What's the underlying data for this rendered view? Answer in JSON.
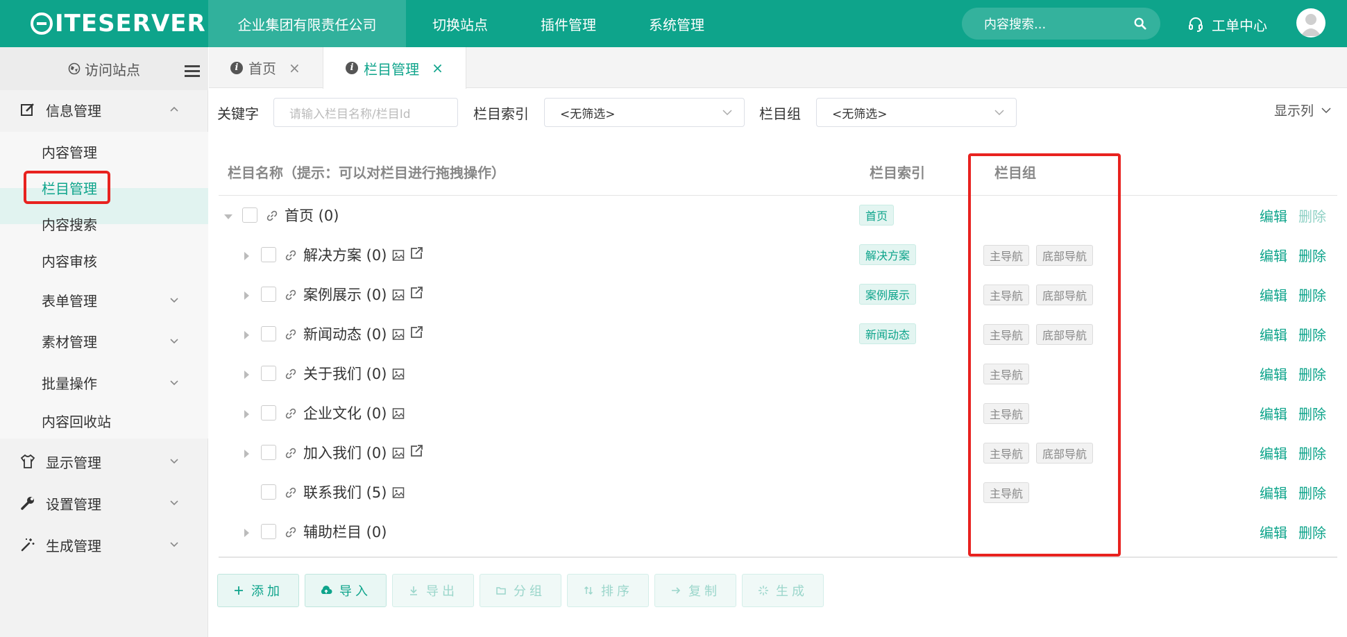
{
  "brand": {
    "logo_text": "ITESERVER"
  },
  "topnav": {
    "items": [
      "企业集团有限责任公司",
      "切换站点",
      "插件管理",
      "系统管理"
    ],
    "search_placeholder": "内容搜索...",
    "workorder": "工单中心"
  },
  "sidebar": {
    "visit": "访问站点",
    "groups": {
      "info": "信息管理",
      "display": "显示管理",
      "settings": "设置管理",
      "generate": "生成管理"
    },
    "subs": {
      "content": "内容管理",
      "channel": "栏目管理",
      "search": "内容搜索",
      "audit": "内容审核",
      "form": "表单管理",
      "material": "素材管理",
      "batch": "批量操作",
      "recycle": "内容回收站"
    }
  },
  "tabs": {
    "home": "首页",
    "channel": "栏目管理",
    "close": "×"
  },
  "filters": {
    "keyword_label": "关键字",
    "keyword_placeholder": "请输入栏目名称/栏目Id",
    "index_label": "栏目索引",
    "index_value": "<无筛选>",
    "group_label": "栏目组",
    "group_value": "<无筛选>",
    "show_columns": "显示列"
  },
  "table": {
    "headers": {
      "name": "栏目名称（提示：可以对栏目进行拖拽操作）",
      "index": "栏目索引",
      "group": "栏目组"
    },
    "edit": "编辑",
    "delete": "删除",
    "rows": [
      {
        "name": "首页 (0)",
        "index": "首页",
        "groups": [],
        "level": 0,
        "expanded": true,
        "image": false,
        "external": false,
        "arrow": true,
        "delete_disabled": true
      },
      {
        "name": "解决方案 (0)",
        "index": "解决方案",
        "groups": [
          "主导航",
          "底部导航"
        ],
        "level": 1,
        "image": true,
        "external": true,
        "arrow": true
      },
      {
        "name": "案例展示 (0)",
        "index": "案例展示",
        "groups": [
          "主导航",
          "底部导航"
        ],
        "level": 1,
        "image": true,
        "external": true,
        "arrow": true
      },
      {
        "name": "新闻动态 (0)",
        "index": "新闻动态",
        "groups": [
          "主导航",
          "底部导航"
        ],
        "level": 1,
        "image": true,
        "external": true,
        "arrow": true
      },
      {
        "name": "关于我们 (0)",
        "index": "",
        "groups": [
          "主导航"
        ],
        "level": 1,
        "image": true,
        "external": false,
        "arrow": true
      },
      {
        "name": "企业文化 (0)",
        "index": "",
        "groups": [
          "主导航"
        ],
        "level": 1,
        "image": true,
        "external": false,
        "arrow": true
      },
      {
        "name": "加入我们 (0)",
        "index": "",
        "groups": [
          "主导航",
          "底部导航"
        ],
        "level": 1,
        "image": true,
        "external": true,
        "arrow": true
      },
      {
        "name": "联系我们 (5)",
        "index": "",
        "groups": [
          "主导航"
        ],
        "level": 1,
        "image": true,
        "external": false,
        "arrow": false
      },
      {
        "name": "辅助栏目 (0)",
        "index": "",
        "groups": [],
        "level": 1,
        "image": false,
        "external": false,
        "arrow": true
      }
    ]
  },
  "buttons": {
    "add": "添加",
    "import": "导入",
    "export": "导出",
    "group": "分组",
    "sort": "排序",
    "copy": "复制",
    "generate": "生成"
  },
  "colors": {
    "brand": "#0ea48b",
    "highlight": "#e8221f"
  }
}
